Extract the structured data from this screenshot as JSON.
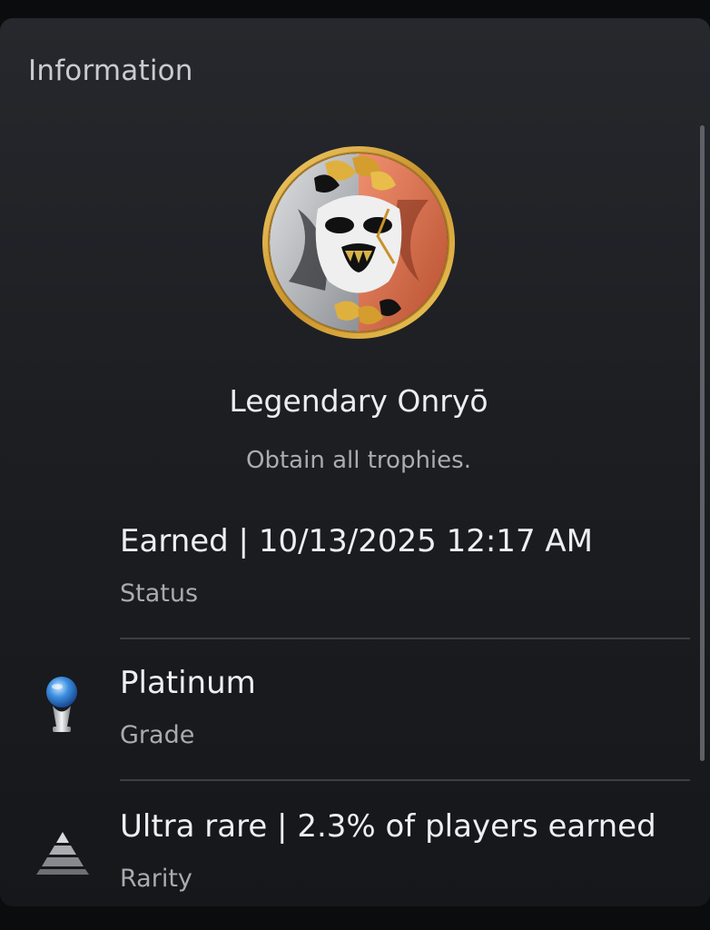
{
  "panel": {
    "title": "Information"
  },
  "trophy": {
    "name": "Legendary Onryō",
    "description": "Obtain all trophies.",
    "art_icon": "onryo-mask-trophy-icon",
    "colors": {
      "gold_ring": "#d7a93c",
      "orange_fox": "#e1714c",
      "silver_wolf": "#b9bcc0"
    }
  },
  "rows": [
    {
      "value": "Earned | 10/13/2025  12:17 AM",
      "label": "Status"
    },
    {
      "value": "Platinum",
      "label": "Grade",
      "icon": "platinum-trophy-icon"
    },
    {
      "value": "Ultra rare | 2.3% of players earned",
      "label": "Rarity",
      "icon": "rarity-pyramid-icon"
    }
  ]
}
